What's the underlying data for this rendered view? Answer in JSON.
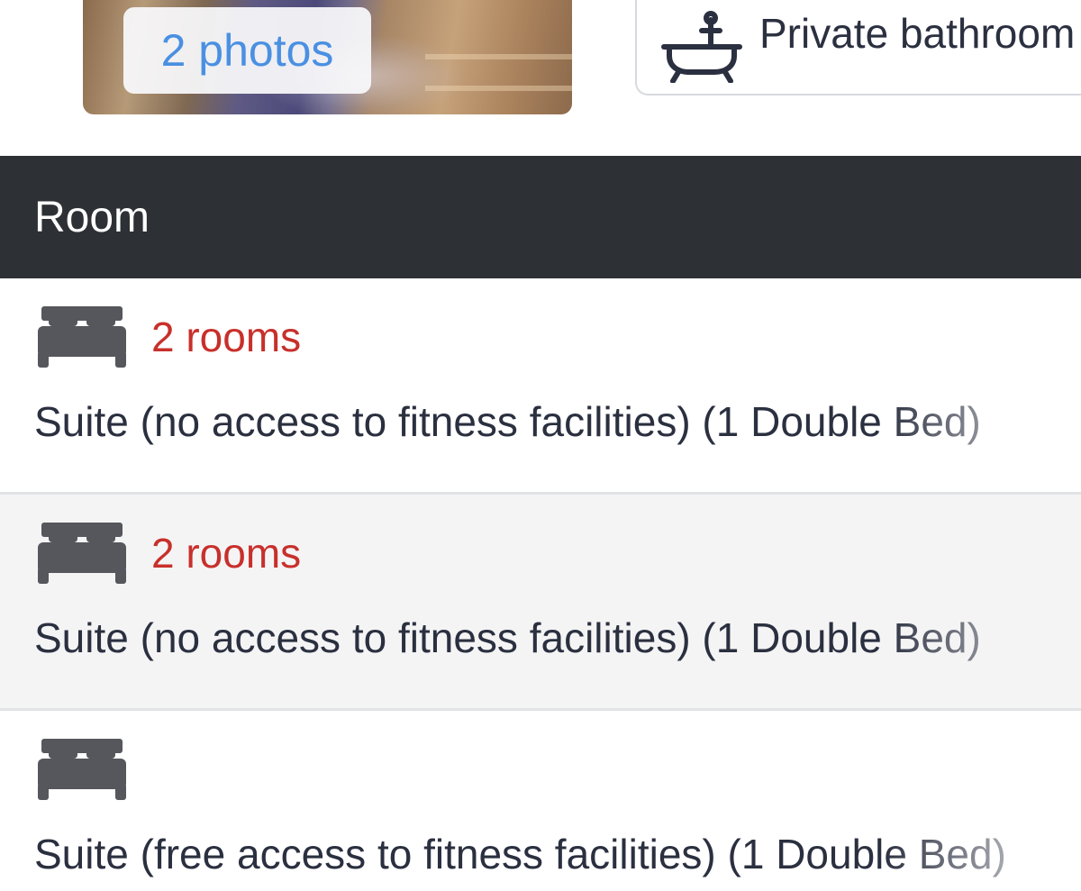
{
  "gallery": {
    "photos_label": "2 photos"
  },
  "facility": {
    "icon": "bathtub-icon",
    "label": "Private bathroom"
  },
  "table": {
    "header": "Room",
    "rows": [
      {
        "icon": "bed-icon",
        "count": "2 rooms",
        "name": "Suite (no access to fitness facilities) (1 Double Bed)"
      },
      {
        "icon": "bed-icon",
        "count": "2 rooms",
        "name": "Suite (no access to fitness facilities) (1 Double Bed)"
      },
      {
        "icon": "bed-icon",
        "count": "",
        "name": "Suite (free access to fitness facilities) (1 Double Bed)"
      }
    ]
  },
  "colors": {
    "header_bg": "#2d3035",
    "count_text": "#c8302b",
    "link_blue": "#4a90e2",
    "alt_row_bg": "#f4f4f5"
  }
}
